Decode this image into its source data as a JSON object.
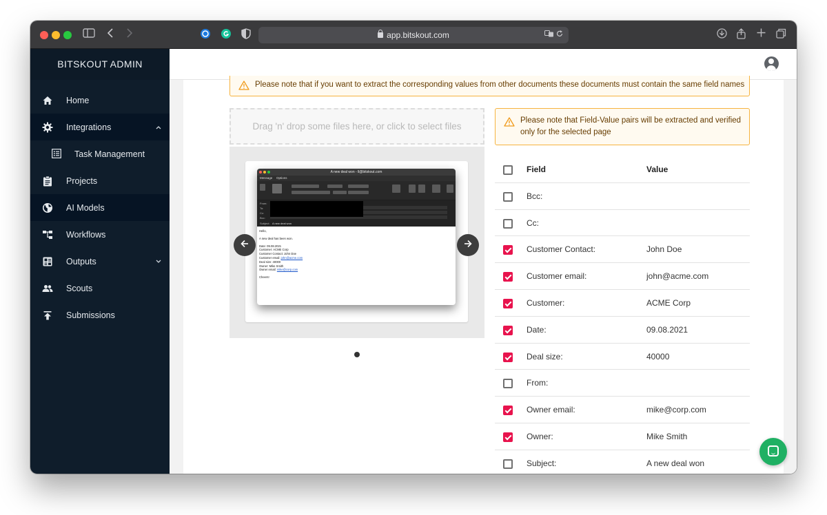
{
  "browser": {
    "url": "app.bitskout.com"
  },
  "sidebar": {
    "brand": "BITSKOUT ADMIN",
    "items": [
      {
        "label": "Home",
        "icon": "home-icon"
      },
      {
        "label": "Integrations",
        "icon": "gear-icon",
        "expanded": true
      },
      {
        "label": "Task Management",
        "icon": "list-icon"
      },
      {
        "label": "Projects",
        "icon": "clipboard-icon"
      },
      {
        "label": "AI Models",
        "icon": "globe-icon",
        "active": true
      },
      {
        "label": "Workflows",
        "icon": "workflow-icon"
      },
      {
        "label": "Outputs",
        "icon": "dashboard-icon",
        "expanded": false
      },
      {
        "label": "Scouts",
        "icon": "people-icon"
      },
      {
        "label": "Submissions",
        "icon": "upload-icon"
      }
    ]
  },
  "alerts": {
    "top": "Please note that if you want to extract the corresponding values from other documents these documents must contain the same field names",
    "side": "Please note that Field-Value pairs will be extracted and verified only for the selected page"
  },
  "dropzone": {
    "text": "Drag 'n' drop some files here, or click to select files"
  },
  "preview": {
    "window_title": "A new deal won - ll@bitskout.com",
    "tabs": [
      "Message",
      "Options"
    ],
    "field_labels": [
      "From:",
      "To:",
      "Cc:",
      "Bcc:",
      "Subject:"
    ],
    "subject": "A new deal won",
    "body": {
      "greeting": "Hello,",
      "intro": "A new deal has been won.",
      "date": "Date: 09.08.2021",
      "customer": "Customer: ACME Corp",
      "contact": "Customer Contact: John Doe",
      "email_label": "Customer email: ",
      "email_link": "john@acme.com",
      "deal_size": "Deal size: 40000",
      "owner": "Owner: Mike Smith",
      "owner_email_label": "Owner email: ",
      "owner_email_link": "mike@corp.com",
      "signoff": "Cheers!"
    },
    "page_count": 1,
    "current_page": 1
  },
  "table": {
    "headers": {
      "field": "Field",
      "value": "Value"
    },
    "rows": [
      {
        "field": "Bcc:",
        "value": "",
        "checked": false
      },
      {
        "field": "Cc:",
        "value": "",
        "checked": false
      },
      {
        "field": "Customer Contact:",
        "value": "John Doe",
        "checked": true
      },
      {
        "field": "Customer email:",
        "value": "john@acme.com",
        "checked": true
      },
      {
        "field": "Customer:",
        "value": "ACME Corp",
        "checked": true
      },
      {
        "field": "Date:",
        "value": "09.08.2021",
        "checked": true
      },
      {
        "field": "Deal size:",
        "value": "40000",
        "checked": true
      },
      {
        "field": "From:",
        "value": "",
        "checked": false
      },
      {
        "field": "Owner email:",
        "value": "mike@corp.com",
        "checked": true
      },
      {
        "field": "Owner:",
        "value": "Mike Smith",
        "checked": true
      },
      {
        "field": "Subject:",
        "value": "A new deal won",
        "checked": false
      }
    ]
  },
  "colors": {
    "sidebar": "#0f1d2b",
    "accent_checkbox": "#e8134d",
    "warning_border": "#f6b33e",
    "chat": "#1fb063"
  }
}
